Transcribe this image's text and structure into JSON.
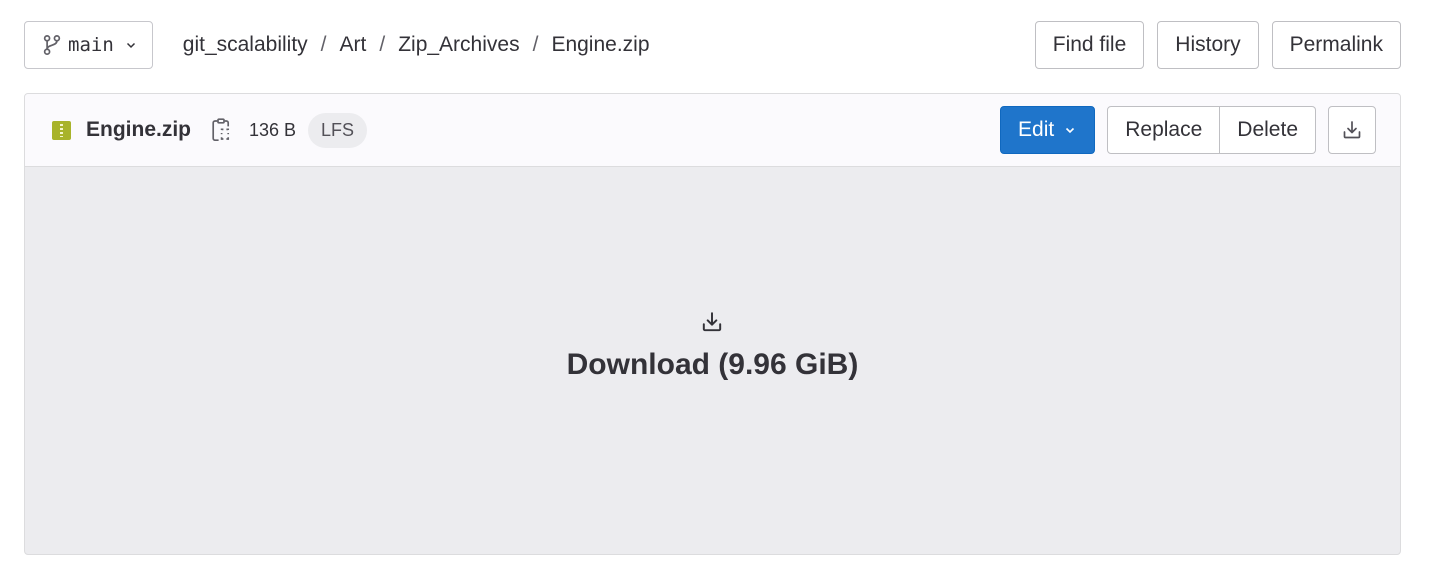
{
  "topbar": {
    "branch": {
      "name": "main",
      "icon": "git-branch-icon"
    },
    "breadcrumb": [
      {
        "label": "git_scalability"
      },
      {
        "label": "Art"
      },
      {
        "label": "Zip_Archives"
      },
      {
        "label": "Engine.zip"
      }
    ],
    "separator": "/",
    "actions": {
      "find_file": "Find file",
      "history": "History",
      "permalink": "Permalink"
    }
  },
  "file": {
    "icon": "zip-file-icon",
    "name": "Engine.zip",
    "size": "136 B",
    "badge": "LFS",
    "actions": {
      "edit": "Edit",
      "replace": "Replace",
      "delete": "Delete"
    },
    "body": {
      "download_label": "Download (9.96 GiB)"
    }
  },
  "colors": {
    "primary": "#1f75cb",
    "zip_icon": "#a8b32a",
    "body_bg": "#ececef"
  }
}
